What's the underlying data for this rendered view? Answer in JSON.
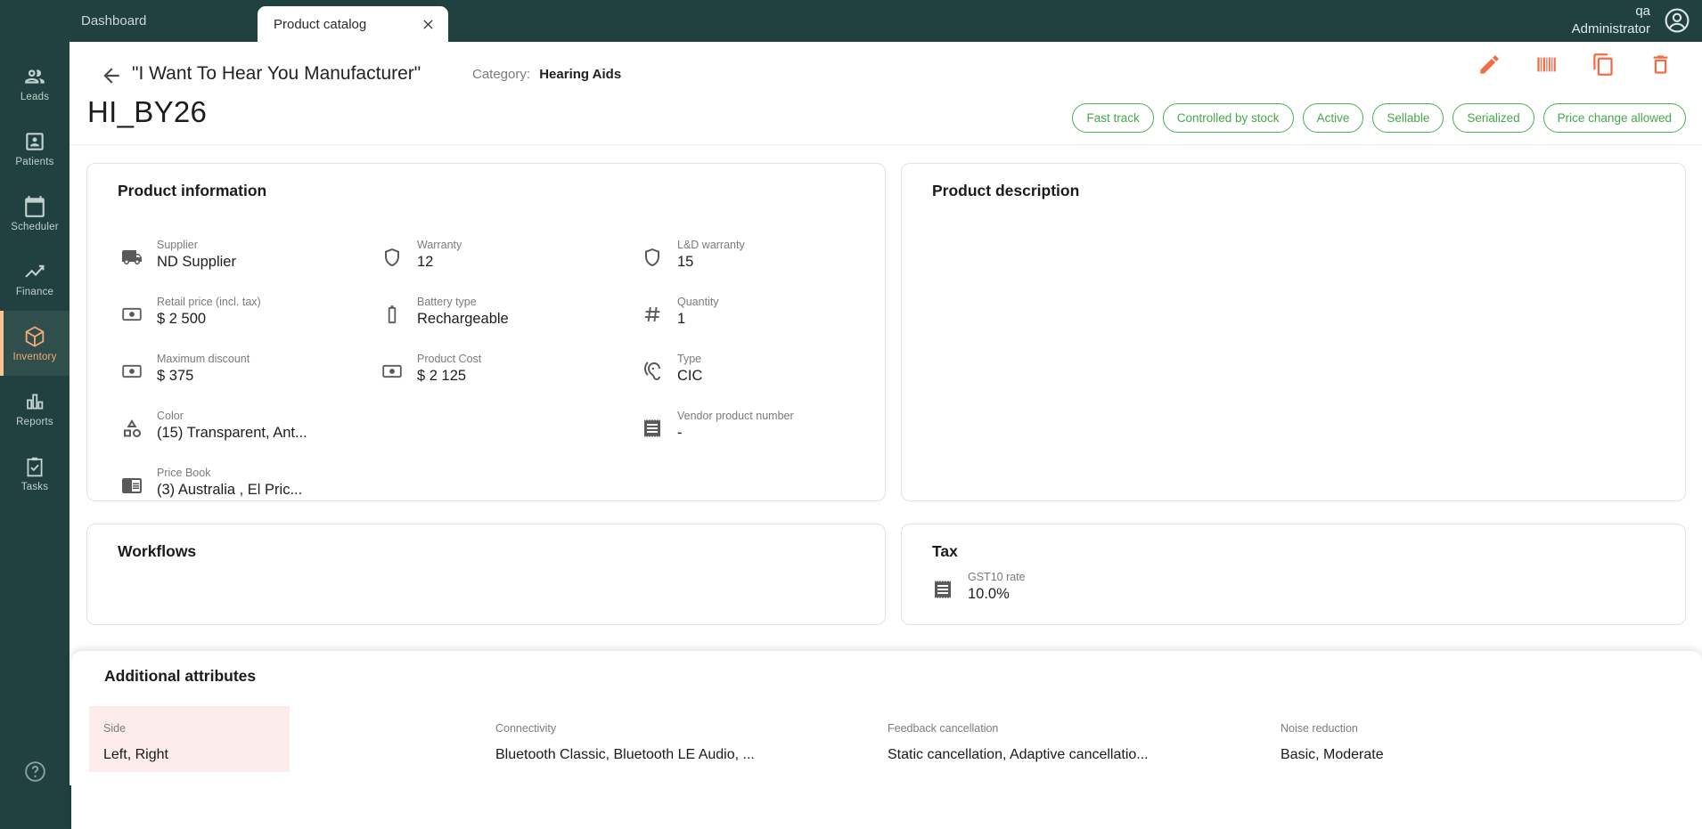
{
  "topbar": {
    "tabs": [
      {
        "label": "Dashboard",
        "active": false
      },
      {
        "label": "Product catalog",
        "active": true
      }
    ],
    "user": {
      "name": "qa",
      "role": "Administrator"
    }
  },
  "sidebar": {
    "items": [
      {
        "label": "Leads",
        "icon": "leads-people-icon",
        "active": false
      },
      {
        "label": "Patients",
        "icon": "patient-card-icon",
        "active": false
      },
      {
        "label": "Scheduler",
        "icon": "calendar-icon",
        "active": false
      },
      {
        "label": "Finance",
        "icon": "finance-chart-icon",
        "active": false
      },
      {
        "label": "Inventory",
        "icon": "inventory-cube-icon",
        "active": true
      },
      {
        "label": "Reports",
        "icon": "bar-chart-icon",
        "active": false
      },
      {
        "label": "Tasks",
        "icon": "tasks-clipboard-icon",
        "active": false
      }
    ]
  },
  "header": {
    "title": "\"I Want To Hear You Manufacturer\"",
    "category_label": "Category:",
    "category_value": "Hearing Aids",
    "product_code": "HI_BY26",
    "actions": [
      {
        "name": "edit",
        "icon": "pencil-icon"
      },
      {
        "name": "barcode",
        "icon": "barcode-icon"
      },
      {
        "name": "duplicate",
        "icon": "copy-icon"
      },
      {
        "name": "delete",
        "icon": "trash-icon"
      }
    ],
    "badges": [
      "Fast track",
      "Controlled by stock",
      "Active",
      "Sellable",
      "Serialized",
      "Price change allowed"
    ]
  },
  "product_information": {
    "title": "Product information",
    "fields": [
      {
        "icon": "truck-icon",
        "label": "Supplier",
        "value": "ND Supplier"
      },
      {
        "icon": "shield-icon",
        "label": "Warranty",
        "value": "12"
      },
      {
        "icon": "shield-icon",
        "label": "L&D warranty",
        "value": "15"
      },
      {
        "icon": "money-icon",
        "label": "Retail price (incl. tax)",
        "value": "$ 2 500"
      },
      {
        "icon": "battery-icon",
        "label": "Battery type",
        "value": "Rechargeable"
      },
      {
        "icon": "hash-icon",
        "label": "Quantity",
        "value": "1"
      },
      {
        "icon": "money-icon",
        "label": "Maximum discount",
        "value": "$ 375"
      },
      {
        "icon": "money-icon",
        "label": "Product Cost",
        "value": "$ 2 125"
      },
      {
        "icon": "ear-icon",
        "label": "Type",
        "value": "CIC"
      },
      {
        "icon": "shapes-icon",
        "label": "Color",
        "value": "(15) Transparent, Ant..."
      },
      {
        "icon": "receipt-icon",
        "label": "Vendor product number",
        "value": "-"
      },
      {
        "icon": "book-icon",
        "label": "Price Book",
        "value": "(3) Australia , El Pric..."
      }
    ]
  },
  "product_description": {
    "title": "Product description"
  },
  "workflows": {
    "title": "Workflows"
  },
  "tax": {
    "title": "Tax",
    "fields": [
      {
        "icon": "receipt-icon",
        "label": "GST10 rate",
        "value": "10.0%"
      }
    ]
  },
  "additional_attributes": {
    "title": "Additional attributes",
    "attributes": [
      {
        "label": "Side",
        "value": "Left, Right",
        "highlighted": true
      },
      {
        "label": "Connectivity",
        "value": "Bluetooth Classic, Bluetooth LE Audio, ...",
        "highlighted": false
      },
      {
        "label": "Feedback cancellation",
        "value": "Static cancellation, Adaptive cancellatio...",
        "highlighted": false
      },
      {
        "label": "Noise reduction",
        "value": "Basic, Moderate",
        "highlighted": false
      }
    ]
  },
  "colors": {
    "sidebar_bg": "#20413f",
    "active_accent": "#f2ab75",
    "action_orange": "#f46a45",
    "badge_green": "#4caf50",
    "highlight_pink": "#fdecec"
  }
}
